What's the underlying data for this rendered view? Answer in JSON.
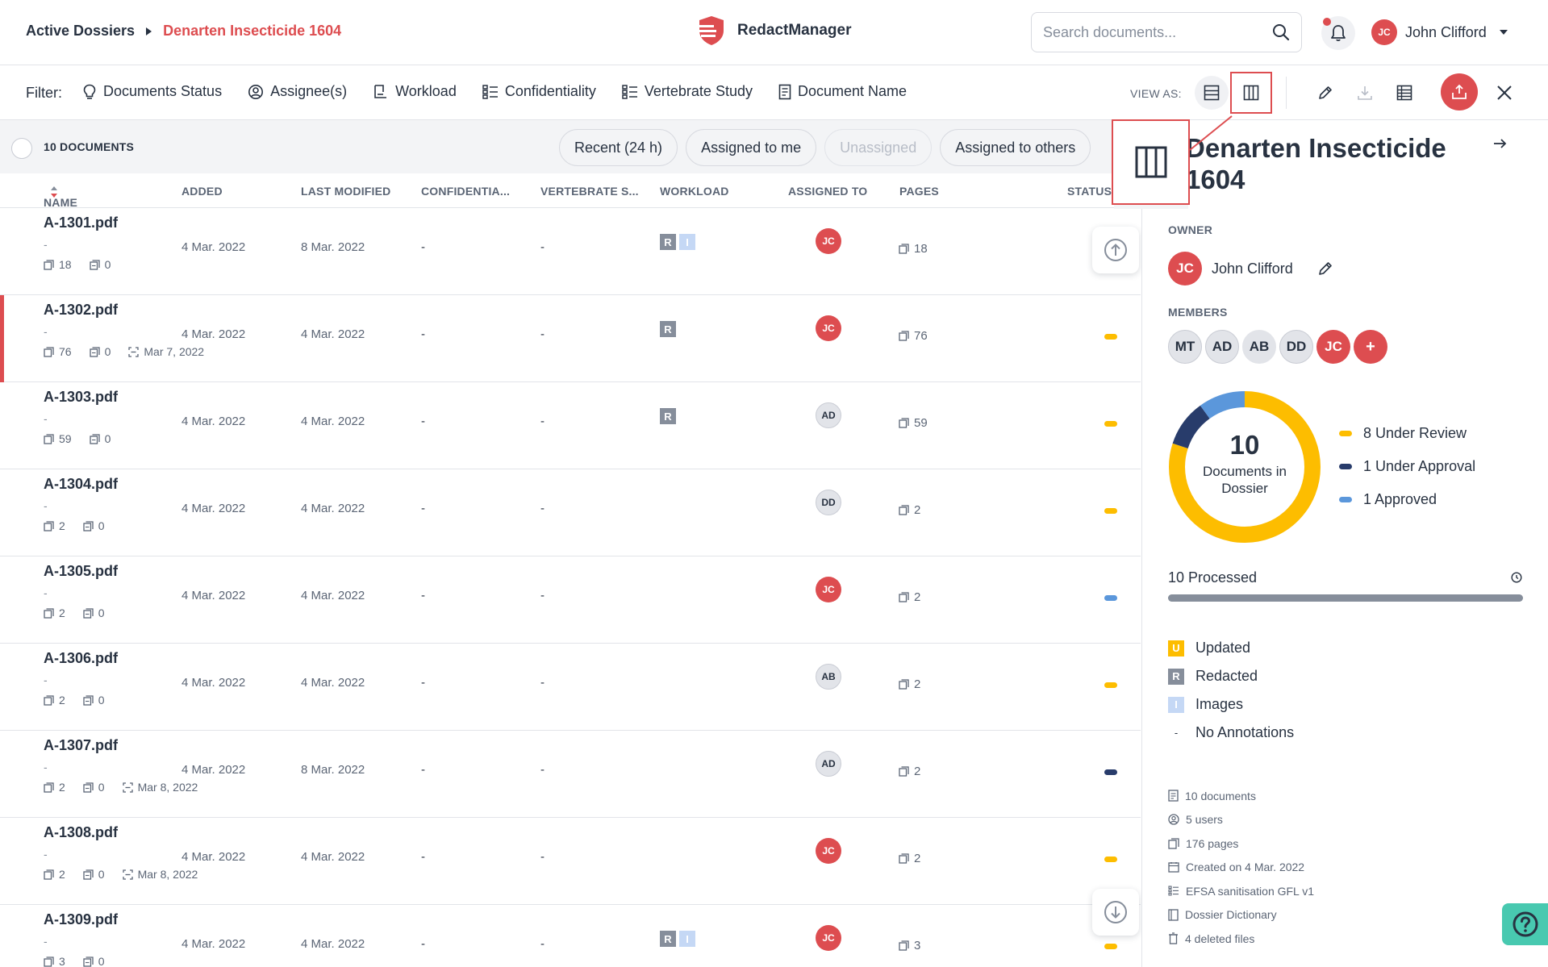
{
  "header": {
    "breadcrumb_root": "Active Dossiers",
    "breadcrumb_current": "Denarten Insecticide 1604",
    "brand_name": "RedactManager",
    "search_placeholder": "Search documents...",
    "user_initials": "JC",
    "user_name": "John Clifford"
  },
  "filter_bar": {
    "label": "Filter:",
    "filters": [
      {
        "label": "Documents Status",
        "icon": "lightbulb-icon"
      },
      {
        "label": "Assignee(s)",
        "icon": "user-circle-icon"
      },
      {
        "label": "Workload",
        "icon": "workload-icon"
      },
      {
        "label": "Confidentiality",
        "icon": "list-icon"
      },
      {
        "label": "Vertebrate Study",
        "icon": "list-icon"
      },
      {
        "label": "Document Name",
        "icon": "document-icon"
      }
    ],
    "view_as_label": "VIEW AS:"
  },
  "table": {
    "documents_count": "10 DOCUMENTS",
    "quick_filters": [
      "Recent (24 h)",
      "Assigned to me",
      "Unassigned",
      "Assigned to others"
    ],
    "columns": [
      "NAME",
      "ADDED",
      "LAST MODIFIED",
      "CONFIDENTIA...",
      "VERTEBRATE S...",
      "WORKLOAD",
      "ASSIGNED TO",
      "PAGES",
      "STATUS"
    ],
    "rows": [
      {
        "name": "A-1301.pdf",
        "sub": "-",
        "pages_meta": "18",
        "annot_meta": "0",
        "date_meta": "",
        "added": "4 Mar. 2022",
        "modified": "8 Mar. 2022",
        "conf": "-",
        "vert": "-",
        "workload": [
          "R",
          "I"
        ],
        "assignee": "JC",
        "assignee_red": true,
        "pages": "18",
        "status": "none",
        "flagged": false
      },
      {
        "name": "A-1302.pdf",
        "sub": "-",
        "pages_meta": "76",
        "annot_meta": "0",
        "date_meta": "Mar 7, 2022",
        "added": "4 Mar. 2022",
        "modified": "4 Mar. 2022",
        "conf": "-",
        "vert": "-",
        "workload": [
          "R"
        ],
        "assignee": "JC",
        "assignee_red": true,
        "pages": "76",
        "status": "review",
        "flagged": true
      },
      {
        "name": "A-1303.pdf",
        "sub": "-",
        "pages_meta": "59",
        "annot_meta": "0",
        "date_meta": "",
        "added": "4 Mar. 2022",
        "modified": "4 Mar. 2022",
        "conf": "-",
        "vert": "-",
        "workload": [
          "R"
        ],
        "assignee": "AD",
        "assignee_red": false,
        "pages": "59",
        "status": "review",
        "flagged": false
      },
      {
        "name": "A-1304.pdf",
        "sub": "-",
        "pages_meta": "2",
        "annot_meta": "0",
        "date_meta": "",
        "added": "4 Mar. 2022",
        "modified": "4 Mar. 2022",
        "conf": "-",
        "vert": "-",
        "workload": [],
        "assignee": "DD",
        "assignee_red": false,
        "pages": "2",
        "status": "review",
        "flagged": false
      },
      {
        "name": "A-1305.pdf",
        "sub": "-",
        "pages_meta": "2",
        "annot_meta": "0",
        "date_meta": "",
        "added": "4 Mar. 2022",
        "modified": "4 Mar. 2022",
        "conf": "-",
        "vert": "-",
        "workload": [],
        "assignee": "JC",
        "assignee_red": true,
        "pages": "2",
        "status": "approved",
        "flagged": false
      },
      {
        "name": "A-1306.pdf",
        "sub": "-",
        "pages_meta": "2",
        "annot_meta": "0",
        "date_meta": "",
        "added": "4 Mar. 2022",
        "modified": "4 Mar. 2022",
        "conf": "-",
        "vert": "-",
        "workload": [],
        "assignee": "AB",
        "assignee_red": false,
        "pages": "2",
        "status": "review",
        "flagged": false
      },
      {
        "name": "A-1307.pdf",
        "sub": "-",
        "pages_meta": "2",
        "annot_meta": "0",
        "date_meta": "Mar 8, 2022",
        "added": "4 Mar. 2022",
        "modified": "8 Mar. 2022",
        "conf": "-",
        "vert": "-",
        "workload": [],
        "assignee": "AD",
        "assignee_red": false,
        "pages": "2",
        "status": "approval",
        "flagged": false
      },
      {
        "name": "A-1308.pdf",
        "sub": "-",
        "pages_meta": "2",
        "annot_meta": "0",
        "date_meta": "Mar 8, 2022",
        "added": "4 Mar. 2022",
        "modified": "4 Mar. 2022",
        "conf": "-",
        "vert": "-",
        "workload": [],
        "assignee": "JC",
        "assignee_red": true,
        "pages": "2",
        "status": "review",
        "flagged": false
      },
      {
        "name": "A-1309.pdf",
        "sub": "-",
        "pages_meta": "3",
        "annot_meta": "0",
        "date_meta": "",
        "added": "4 Mar. 2022",
        "modified": "4 Mar. 2022",
        "conf": "-",
        "vert": "-",
        "workload": [
          "R",
          "I"
        ],
        "assignee": "JC",
        "assignee_red": true,
        "pages": "3",
        "status": "review",
        "flagged": false
      }
    ]
  },
  "panel": {
    "title": "Denarten Insecticide 1604",
    "owner_label": "OWNER",
    "owner_initials": "JC",
    "owner_name": "John Clifford",
    "members_label": "MEMBERS",
    "members": [
      "MT",
      "AD",
      "AB",
      "DD",
      "JC"
    ],
    "add_member_glyph": "+",
    "donut_number": "10",
    "donut_caption": "Documents in Dossier",
    "legend": [
      {
        "label": "8 Under Review",
        "color": "#fdbd00"
      },
      {
        "label": "1 Under Approval",
        "color": "#283c6b"
      },
      {
        "label": "1 Approved",
        "color": "#5b97db"
      }
    ],
    "processed_label": "10 Processed",
    "processed_fraction": 1.0,
    "keys": [
      {
        "glyph": "U",
        "label": "Updated",
        "color": "#fdbd00"
      },
      {
        "glyph": "R",
        "label": "Redacted",
        "color": "#868e9b"
      },
      {
        "glyph": "I",
        "label": "Images",
        "color": "#c5d8f5"
      },
      {
        "glyph": "-",
        "label": "No Annotations",
        "color": ""
      }
    ],
    "stats": [
      {
        "label": "10 documents",
        "icon": "document-icon"
      },
      {
        "label": "5 users",
        "icon": "user-circle-icon"
      },
      {
        "label": "176 pages",
        "icon": "pages-icon"
      },
      {
        "label": "Created on 4 Mar. 2022",
        "icon": "calendar-icon"
      },
      {
        "label": "EFSA sanitisation GFL v1",
        "icon": "list-icon"
      },
      {
        "label": "Dossier Dictionary",
        "icon": "book-icon"
      },
      {
        "label": "4 deleted files",
        "icon": "trash-icon"
      }
    ]
  },
  "colors": {
    "accent": "#dd4d50",
    "review": "#fdbd00",
    "approval": "#283c6b",
    "approved": "#5b97db"
  }
}
